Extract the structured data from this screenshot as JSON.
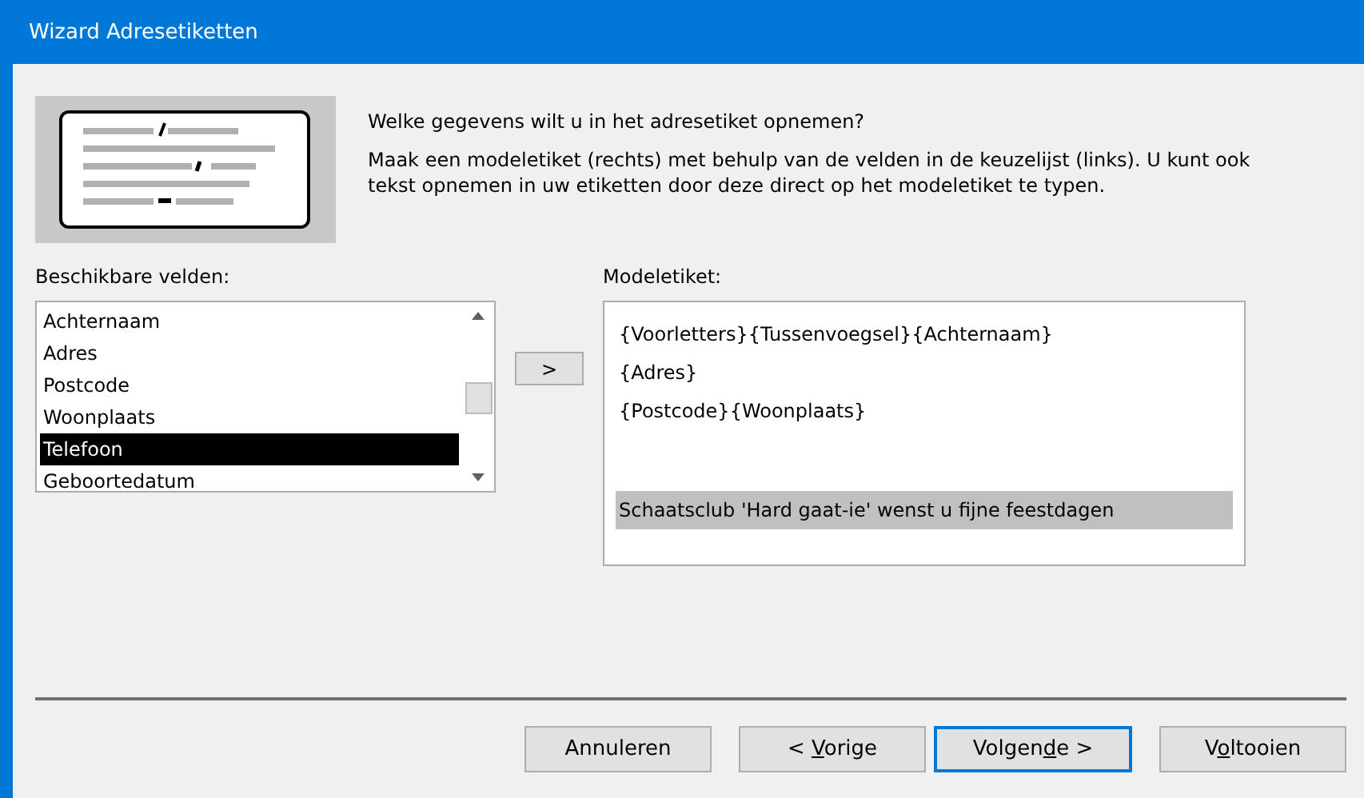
{
  "window": {
    "title": "Wizard Adresetiketten"
  },
  "intro": {
    "question": "Welke gegevens wilt u in het adresetiket opnemen?",
    "explanation": "Maak een modeletiket (rechts) met behulp van de velden in de keuzelijst (links). U kunt ook tekst opnemen in uw etiketten door deze direct op het modeletiket te typen."
  },
  "available_fields": {
    "label": "Beschikbare velden:",
    "items": [
      {
        "text": "Achternaam",
        "selected": false
      },
      {
        "text": "Adres",
        "selected": false
      },
      {
        "text": "Postcode",
        "selected": false
      },
      {
        "text": "Woonplaats",
        "selected": false
      },
      {
        "text": "Telefoon",
        "selected": true
      },
      {
        "text": "Geboortedatum",
        "selected": false
      }
    ]
  },
  "add_button": {
    "label": ">"
  },
  "model_label": {
    "label": "Modeletiket:",
    "lines": [
      {
        "text": "{Voorletters}{Tussenvoegsel}{Achternaam}",
        "selected": false
      },
      {
        "text": "{Adres}",
        "selected": false
      },
      {
        "text": "{Postcode}{Woonplaats}",
        "selected": false
      },
      {
        "text": "Schaatsclub 'Hard gaat-ie' wenst u fijne feestdagen",
        "selected": true
      }
    ]
  },
  "buttons": [
    {
      "before": "Annuleren",
      "default": false
    },
    {
      "before": "< ",
      "key": "V",
      "after": "orige",
      "default": false
    },
    {
      "before": "Volgen",
      "key": "d",
      "after": "e >",
      "default": true
    },
    {
      "before": "V",
      "key": "o",
      "after": "ltooien",
      "default": false
    }
  ]
}
